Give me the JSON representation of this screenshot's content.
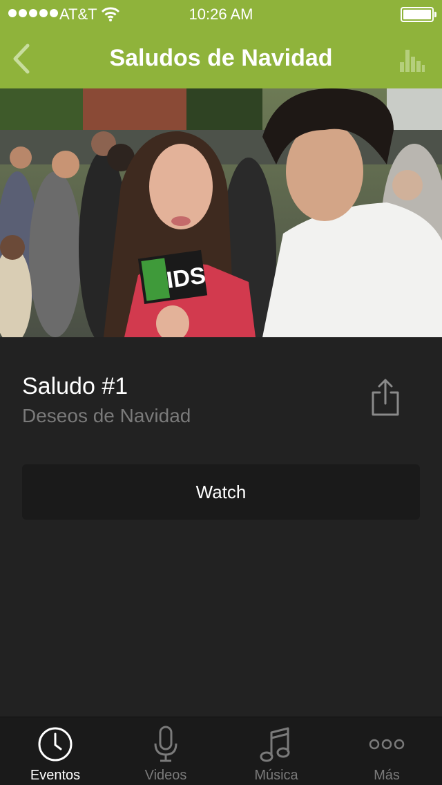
{
  "status_bar": {
    "carrier": "AT&T",
    "time": "10:26 AM",
    "signal_bars": 5,
    "battery_level": 1.0
  },
  "nav": {
    "title": "Saludos de Navidad",
    "back_icon": "chevron-left-icon",
    "right_icon": "bar-chart-icon"
  },
  "hero": {
    "mic_flag_text": "IDS"
  },
  "item": {
    "title": "Saludo #1",
    "subtitle": "Deseos de Navidad",
    "share_icon": "share-icon"
  },
  "watch_button": {
    "label": "Watch"
  },
  "tabs": [
    {
      "label": "Eventos",
      "icon": "clock-icon",
      "active": true
    },
    {
      "label": "Videos",
      "icon": "microphone-icon",
      "active": false
    },
    {
      "label": "Música",
      "icon": "music-note-icon",
      "active": false
    },
    {
      "label": "Más",
      "icon": "more-icon",
      "active": false
    }
  ],
  "colors": {
    "header": "#8fb33b",
    "background": "#222222",
    "tab_bar": "#1a1a1a",
    "button": "#1a1a1a",
    "subtitle": "#7a7a7a"
  }
}
